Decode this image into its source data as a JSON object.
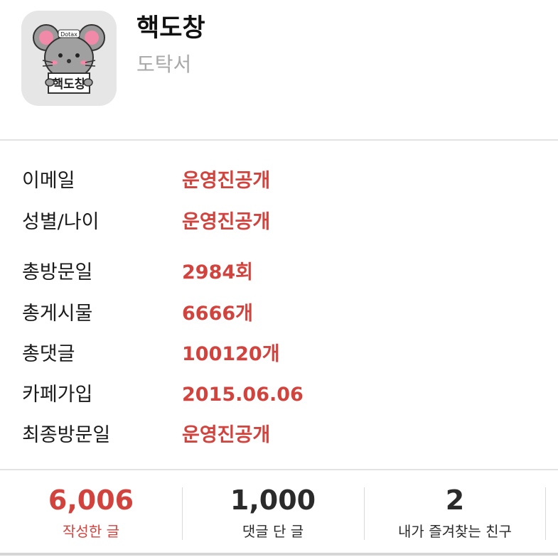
{
  "profile": {
    "nickname": "핵도창",
    "sub_name": "도탁서",
    "avatar_sign_text": "핵도창",
    "avatar_badge_text": "Dotax"
  },
  "info_rows": [
    {
      "label": "이메일",
      "value": "운영진공개"
    },
    {
      "label": "성별/나이",
      "value": "운영진공개"
    },
    {
      "label": "총방문일",
      "value": "2984회"
    },
    {
      "label": "총게시물",
      "value": "6666개"
    },
    {
      "label": "총댓글",
      "value": "100120개"
    },
    {
      "label": "카페가입",
      "value": "2015.06.06"
    },
    {
      "label": "최종방문일",
      "value": "운영진공개"
    }
  ],
  "stats": [
    {
      "number": "6,006",
      "caption": "작성한 글"
    },
    {
      "number": "1,000",
      "caption": "댓글 단 글"
    },
    {
      "number": "2",
      "caption": "내가 즐겨찾는 친구"
    }
  ],
  "colors": {
    "accent": "#d2433d",
    "muted": "#a8a8a8",
    "divider": "#e3e3e3"
  }
}
